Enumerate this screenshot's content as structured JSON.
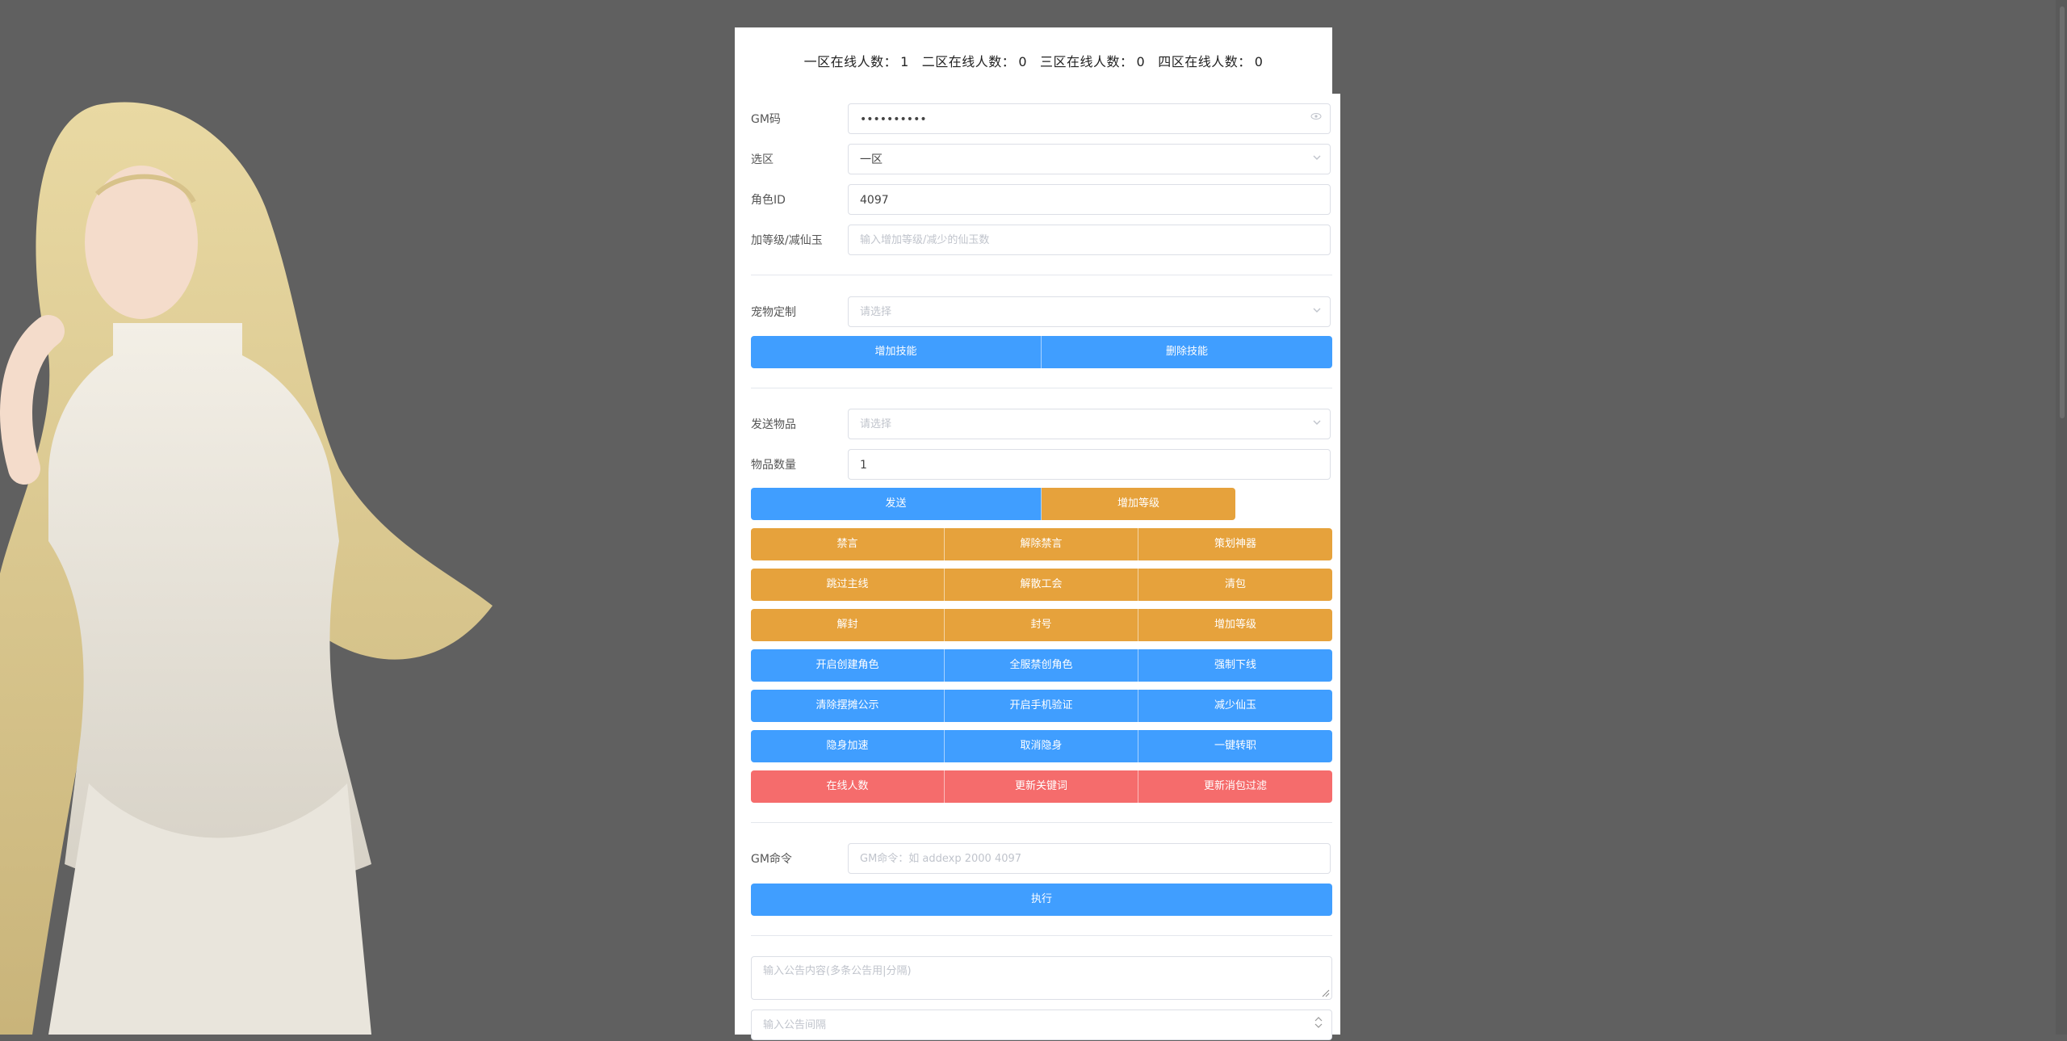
{
  "online": {
    "zone1_label": "一区在线人数：",
    "zone1_value": "1",
    "zone2_label": "二区在线人数：",
    "zone2_value": "0",
    "zone3_label": "三区在线人数：",
    "zone3_value": "0",
    "zone4_label": "四区在线人数：",
    "zone4_value": "0"
  },
  "form": {
    "gm_code_label": "GM码",
    "gm_code_value": "••••••••••",
    "zone_label": "选区",
    "zone_value": "一区",
    "role_id_label": "角色ID",
    "role_id_value": "4097",
    "level_label": "加等级/减仙玉",
    "level_placeholder": "输入增加等级/减少的仙玉数",
    "pet_label": "宠物定制",
    "pet_placeholder": "请选择",
    "item_label": "发送物品",
    "item_placeholder": "请选择",
    "qty_label": "物品数量",
    "qty_value": "1",
    "gm_cmd_label": "GM命令",
    "gm_cmd_placeholder": "GM命令：如 addexp 2000 4097",
    "notice_placeholder": "输入公告内容(多条公告用|分隔)",
    "interval_placeholder": "输入公告间隔"
  },
  "buttons": {
    "add_skill": "增加技能",
    "del_skill": "删除技能",
    "send": "发送",
    "add_level": "增加等级",
    "grid": [
      [
        "禁言",
        "解除禁言",
        "策划神器"
      ],
      [
        "跳过主线",
        "解散工会",
        "清包"
      ],
      [
        "解封",
        "封号",
        "增加等级"
      ],
      [
        "开启创建角色",
        "全服禁创角色",
        "强制下线"
      ],
      [
        "清除摆摊公示",
        "开启手机验证",
        "减少仙玉"
      ],
      [
        "隐身加速",
        "取消隐身",
        "一键转职"
      ],
      [
        "在线人数",
        "更新关键词",
        "更新消包过滤"
      ]
    ],
    "execute": "执行"
  },
  "colors": {
    "primary": "#409eff",
    "warning": "#e6a23c",
    "danger": "#f56c6c",
    "background": "#606060"
  },
  "icons": {
    "password_toggle": "eye-icon",
    "select_arrow": "chevron-down-icon"
  }
}
